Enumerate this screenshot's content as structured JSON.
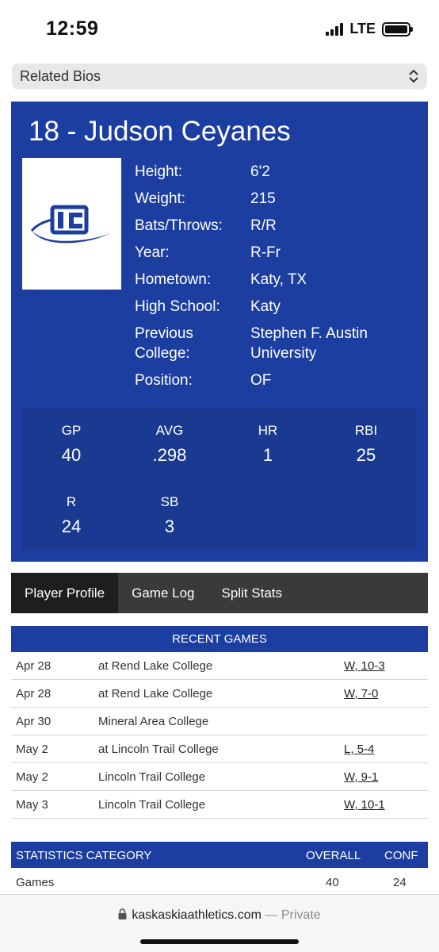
{
  "status_bar": {
    "time": "12:59",
    "network": "LTE"
  },
  "related_bios": {
    "label": "Related Bios"
  },
  "player": {
    "title": "18 - Judson Ceyanes",
    "info": [
      {
        "label": "Height:",
        "value": "6'2"
      },
      {
        "label": "Weight:",
        "value": "215"
      },
      {
        "label": "Bats/Throws:",
        "value": "R/R"
      },
      {
        "label": "Year:",
        "value": "R-Fr"
      },
      {
        "label": "Hometown:",
        "value": "Katy, TX"
      },
      {
        "label": "High School:",
        "value": "Katy"
      },
      {
        "label": "Previous College:",
        "value": "Stephen F. Austin University"
      },
      {
        "label": "Position:",
        "value": "OF"
      }
    ],
    "stats": [
      {
        "label": "GP",
        "value": "40"
      },
      {
        "label": "AVG",
        "value": ".298"
      },
      {
        "label": "HR",
        "value": "1"
      },
      {
        "label": "RBI",
        "value": "25"
      },
      {
        "label": "R",
        "value": "24"
      },
      {
        "label": "SB",
        "value": "3"
      }
    ]
  },
  "tabs": [
    {
      "label": "Player Profile",
      "active": true
    },
    {
      "label": "Game Log",
      "active": false
    },
    {
      "label": "Split Stats",
      "active": false
    }
  ],
  "recent_games": {
    "header": "RECENT GAMES",
    "rows": [
      {
        "date": "Apr 28",
        "opponent": "at Rend Lake College",
        "result": "W, 10-3"
      },
      {
        "date": "Apr 28",
        "opponent": "at Rend Lake College",
        "result": "W, 7-0"
      },
      {
        "date": "Apr 30",
        "opponent": "Mineral Area College",
        "result": ""
      },
      {
        "date": "May 2",
        "opponent": "at Lincoln Trail College",
        "result": "L, 5-4"
      },
      {
        "date": "May 2",
        "opponent": "Lincoln Trail College",
        "result": "W, 9-1"
      },
      {
        "date": "May 3",
        "opponent": "Lincoln Trail College",
        "result": "W, 10-1"
      }
    ]
  },
  "statistics": {
    "headers": {
      "category": "STATISTICS CATEGORY",
      "overall": "OVERALL",
      "conf": "CONF"
    },
    "rows": [
      {
        "category": "Games",
        "overall": "40",
        "conf": "24"
      }
    ]
  },
  "browser": {
    "domain": "kaskaskiaathletics.com",
    "separator": "—",
    "mode": "Private"
  },
  "colors": {
    "brand_blue": "#1b3ea0",
    "stats_blue": "#1a3a92",
    "tab_bar": "#3a3a3a",
    "tab_active": "#1e1e1e"
  },
  "icons": [
    "signal-icon",
    "battery-icon",
    "chevron-updown-icon",
    "team-logo",
    "lock-icon"
  ]
}
